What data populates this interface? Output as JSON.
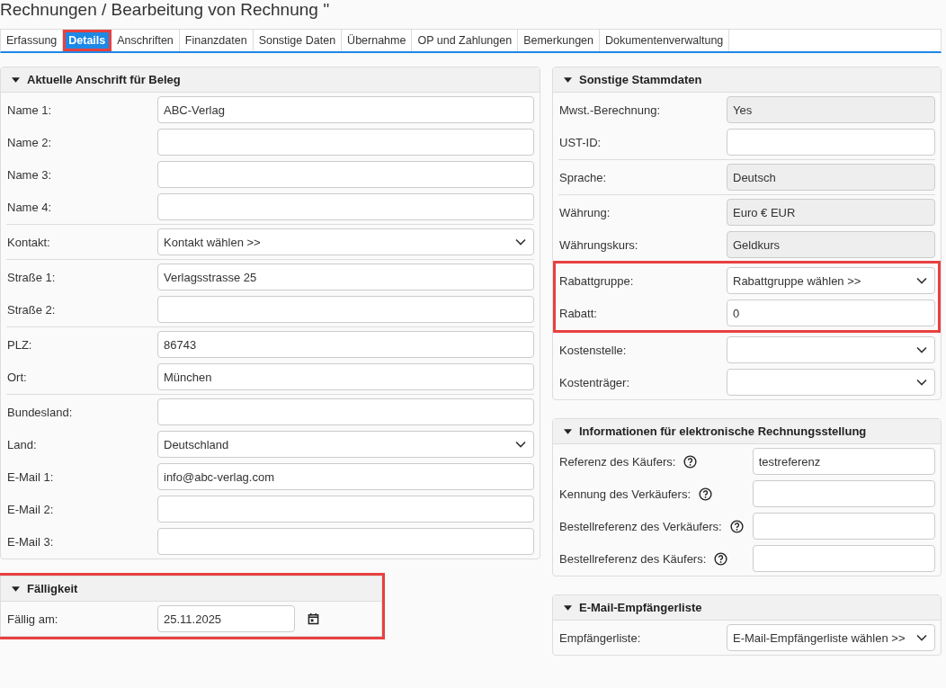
{
  "title": "Rechnungen / Bearbeitung von Rechnung ''",
  "tabs": [
    {
      "label": "Erfassung",
      "selected": false,
      "highlighted": false
    },
    {
      "label": "Details",
      "selected": true,
      "highlighted": true
    },
    {
      "label": "Anschriften",
      "selected": false,
      "highlighted": false
    },
    {
      "label": "Finanzdaten",
      "selected": false,
      "highlighted": false
    },
    {
      "label": "Sonstige Daten",
      "selected": false,
      "highlighted": false
    },
    {
      "label": "Übernahme",
      "selected": false,
      "highlighted": false
    },
    {
      "label": "OP und Zahlungen",
      "selected": false,
      "highlighted": false
    },
    {
      "label": "Bemerkungen",
      "selected": false,
      "highlighted": false
    },
    {
      "label": "Dokumentenverwaltung",
      "selected": false,
      "highlighted": false
    }
  ],
  "columns": [
    {
      "sections": [
        {
          "title": "Aktuelle Anschrift für Beleg",
          "expanded": true,
          "highlighted": false,
          "groups": [
            {
              "highlighted": false,
              "rows": [
                {
                  "label": "Name 1:",
                  "kind": "input",
                  "value": "ABC-Verlag"
                },
                {
                  "label": "Name 2:",
                  "kind": "input"
                },
                {
                  "label": "Name 3:",
                  "kind": "input"
                },
                {
                  "label": "Name 4:",
                  "kind": "input"
                }
              ]
            },
            {
              "highlighted": false,
              "rows": [
                {
                  "label": "Kontakt:",
                  "kind": "select",
                  "value": "Kontakt wählen >>"
                }
              ]
            },
            {
              "highlighted": false,
              "rows": [
                {
                  "label": "Straße 1:",
                  "kind": "input",
                  "value": "Verlagsstrasse 25"
                },
                {
                  "label": "Straße 2:",
                  "kind": "input"
                }
              ]
            },
            {
              "highlighted": false,
              "rows": [
                {
                  "label": "PLZ:",
                  "kind": "input",
                  "value": "86743"
                },
                {
                  "label": "Ort:",
                  "kind": "input",
                  "value": "München"
                }
              ]
            },
            {
              "highlighted": false,
              "rows": [
                {
                  "label": "Bundesland:",
                  "kind": "input"
                },
                {
                  "label": "Land:",
                  "kind": "select",
                  "value": "Deutschland"
                },
                {
                  "label": "E-Mail 1:",
                  "kind": "input",
                  "value": "info@abc-verlag.com"
                },
                {
                  "label": "E-Mail 2:",
                  "kind": "input"
                },
                {
                  "label": "E-Mail 3:",
                  "kind": "input"
                }
              ]
            }
          ]
        },
        {
          "title": "Fälligkeit",
          "expanded": true,
          "highlighted": true,
          "groups": [
            {
              "highlighted": false,
              "rows": [
                {
                  "label": "Fällig am:",
                  "kind": "date",
                  "value": "25.11.2025"
                }
              ]
            }
          ]
        }
      ]
    },
    {
      "sections": [
        {
          "title": "Sonstige Stammdaten",
          "expanded": true,
          "highlighted": false,
          "groups": [
            {
              "highlighted": false,
              "rows": [
                {
                  "label": "Mwst.-Berechnung:",
                  "kind": "readonly",
                  "value": "Yes"
                },
                {
                  "label": "UST-ID:",
                  "kind": "input"
                }
              ]
            },
            {
              "highlighted": false,
              "rows": [
                {
                  "label": "Sprache:",
                  "kind": "readonly",
                  "value": "Deutsch"
                }
              ]
            },
            {
              "highlighted": false,
              "rows": [
                {
                  "label": "Währung:",
                  "kind": "readonly",
                  "value": "Euro € EUR"
                },
                {
                  "label": "Währungskurs:",
                  "kind": "readonly",
                  "value": "Geldkurs"
                }
              ]
            },
            {
              "highlighted": true,
              "rows": [
                {
                  "label": "Rabattgruppe:",
                  "kind": "select",
                  "value": "Rabattgruppe wählen >>"
                },
                {
                  "label": "Rabatt:",
                  "kind": "input",
                  "value": "0"
                }
              ]
            },
            {
              "highlighted": false,
              "rows": [
                {
                  "label": "Kostenstelle:",
                  "kind": "select"
                },
                {
                  "label": "Kostenträger:",
                  "kind": "select"
                }
              ]
            }
          ]
        },
        {
          "title": "Informationen für elektronische Rechnungsstellung",
          "expanded": true,
          "highlighted": false,
          "groups": [
            {
              "highlighted": false,
              "rows": [
                {
                  "label": "Referenz des Käufers:",
                  "kind": "input",
                  "help": true,
                  "value": "testreferenz"
                },
                {
                  "label": "Kennung des Verkäufers:",
                  "kind": "input",
                  "help": true
                },
                {
                  "label": "Bestellreferenz des Verkäufers:",
                  "kind": "input",
                  "help": true
                },
                {
                  "label": "Bestellreferenz des Käufers:",
                  "kind": "input",
                  "help": true
                }
              ]
            }
          ]
        },
        {
          "title": "E-Mail-Empfängerliste",
          "expanded": true,
          "highlighted": false,
          "groups": [
            {
              "highlighted": false,
              "rows": [
                {
                  "label": "Empfängerliste:",
                  "kind": "select",
                  "value": "E-Mail-Empfängerliste wählen >>"
                }
              ]
            }
          ]
        }
      ]
    }
  ]
}
